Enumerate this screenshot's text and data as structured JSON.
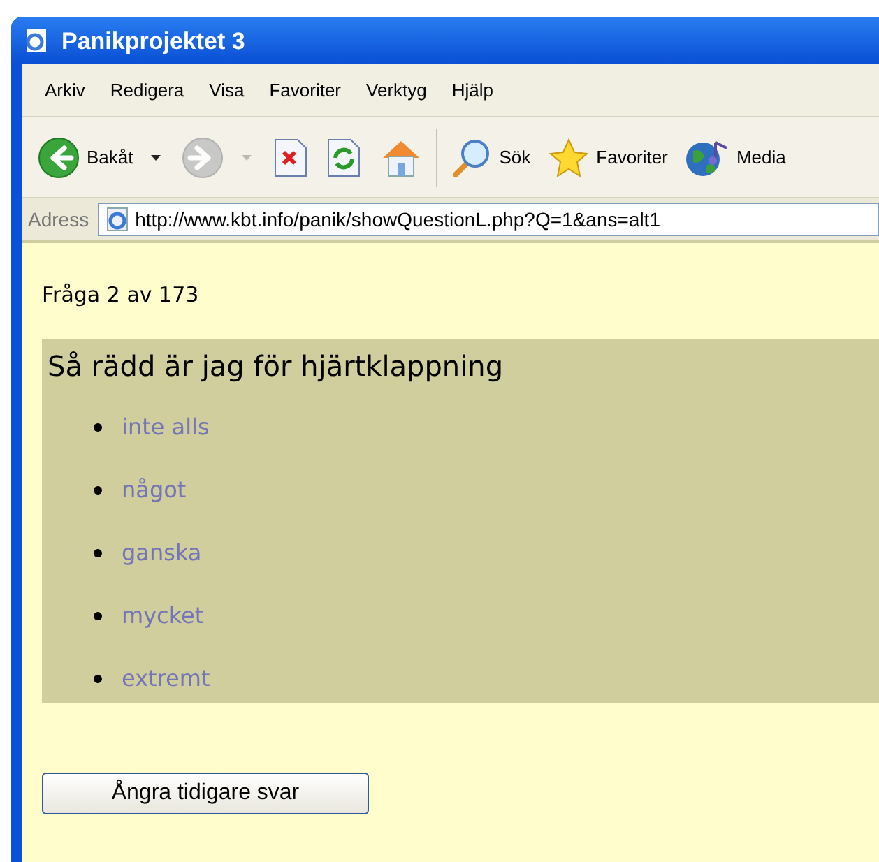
{
  "window": {
    "title": "Panikprojektet 3"
  },
  "menu": [
    "Arkiv",
    "Redigera",
    "Visa",
    "Favoriter",
    "Verktyg",
    "Hjälp"
  ],
  "toolbar": [
    {
      "kind": "back",
      "label": "Bakåt",
      "disabled": false,
      "dropdown": true
    },
    {
      "kind": "forward",
      "disabled": true,
      "dropdown": true
    },
    {
      "kind": "stop",
      "disabled": false,
      "dropdown": false
    },
    {
      "kind": "refresh",
      "disabled": false,
      "dropdown": false
    },
    {
      "kind": "home",
      "disabled": false,
      "dropdown": false
    },
    {
      "kind": "search",
      "label": "Sök",
      "disabled": false,
      "dropdown": false
    },
    {
      "kind": "favorites",
      "label": "Favoriter",
      "disabled": false,
      "dropdown": false
    },
    {
      "kind": "media",
      "label": "Media",
      "disabled": false,
      "dropdown": false
    }
  ],
  "address": {
    "label": "Adress",
    "value": "http://www.kbt.info/panik/showQuestionL.php?Q=1&ans=alt1"
  },
  "page": {
    "counter": "Fråga 2 av 173",
    "question": "Så rädd är jag för hjärtklappning",
    "answers": [
      "inte alls",
      "något",
      "ganska",
      "mycket",
      "extremt"
    ],
    "undo_button": "Ångra tidigare svar"
  }
}
